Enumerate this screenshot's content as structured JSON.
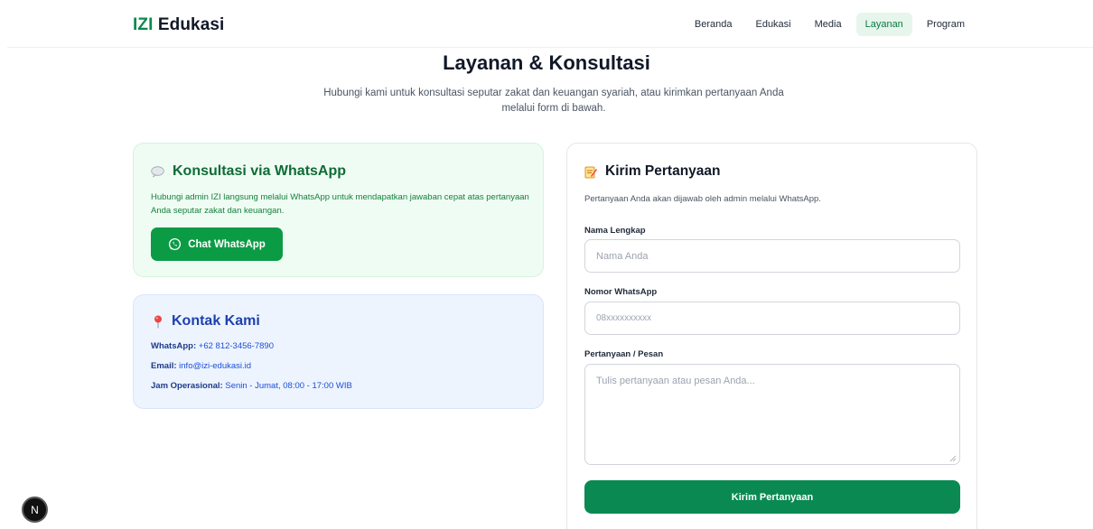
{
  "brand": {
    "accent": "IZI",
    "rest": "Edukasi"
  },
  "nav": [
    {
      "label": "Beranda",
      "active": false
    },
    {
      "label": "Edukasi",
      "active": false
    },
    {
      "label": "Media",
      "active": false
    },
    {
      "label": "Layanan",
      "active": true
    },
    {
      "label": "Program",
      "active": false
    }
  ],
  "header": {
    "title": "Layanan & Konsultasi",
    "subtitle": "Hubungi kami untuk konsultasi seputar zakat dan keuangan syariah, atau kirimkan pertanyaan Anda melalui form di bawah."
  },
  "whatsapp_card": {
    "icon": "speech-bubble-icon",
    "title": "Konsultasi via WhatsApp",
    "description": "Hubungi admin IZI langsung melalui WhatsApp untuk mendapatkan jawaban cepat atas pertanyaan Anda seputar zakat dan keuangan.",
    "button_label": "Chat WhatsApp",
    "button_icon": "whatsapp-icon"
  },
  "contact_card": {
    "icon": "pin-icon",
    "title": "Kontak Kami",
    "lines": [
      {
        "label": "WhatsApp:",
        "value": "+62 812-3456-7890"
      },
      {
        "label": "Email:",
        "value": "info@izi-edukasi.id"
      },
      {
        "label": "Jam Operasional:",
        "value": "Senin - Jumat, 08:00 - 17:00 WIB"
      }
    ]
  },
  "form": {
    "icon": "memo-icon",
    "title": "Kirim Pertanyaan",
    "description": "Pertanyaan Anda akan dijawab oleh admin melalui WhatsApp.",
    "name_label": "Nama Lengkap",
    "name_placeholder": "Nama Anda",
    "phone_label": "Nomor WhatsApp",
    "phone_placeholder": "08xxxxxxxxxx",
    "message_label": "Pertanyaan / Pesan",
    "message_placeholder": "Tulis pertanyaan atau pesan Anda...",
    "submit_label": "Kirim Pertanyaan"
  },
  "dev_badge": "N",
  "colors": {
    "brand_green": "#0a8a4a",
    "whatsapp_button": "#0c9b45",
    "submit_button": "#0a8a52",
    "nav_active_bg": "#e6f6ec",
    "contact_blue": "#1e40af"
  }
}
